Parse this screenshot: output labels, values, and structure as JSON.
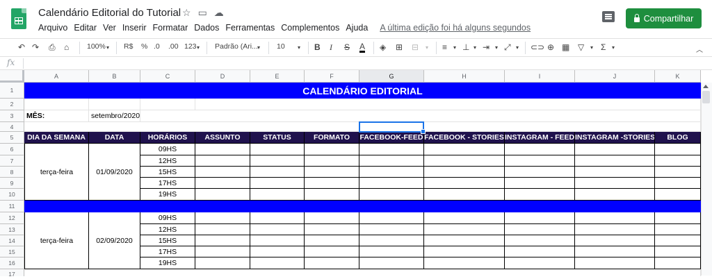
{
  "title": "Calendário Editorial do Tutorial",
  "menu": [
    "Arquivo",
    "Editar",
    "Ver",
    "Inserir",
    "Formatar",
    "Dados",
    "Ferramentas",
    "Complementos",
    "Ajuda"
  ],
  "last_edit": "A última edição foi há alguns segundos",
  "share_label": "Compartilhar",
  "toolbar": {
    "zoom": "100%",
    "currency": "R$",
    "percent": "%",
    "dec_less": ".0",
    "dec_more": ".00",
    "format": "123",
    "font": "Padrão (Ari...",
    "size": "10",
    "bold": "B",
    "italic": "I",
    "strike": "S",
    "textcolor": "A",
    "sigma": "Σ"
  },
  "fx_label": "fx",
  "columns": [
    "A",
    "B",
    "C",
    "D",
    "E",
    "F",
    "G",
    "H",
    "I",
    "J",
    "K"
  ],
  "selected_column": "G",
  "rows": [
    "1",
    "2",
    "3",
    "4",
    "5",
    "6",
    "7",
    "8",
    "9",
    "10",
    "11",
    "12",
    "13",
    "14",
    "15",
    "16",
    "17"
  ],
  "sheet": {
    "banner": "CALENDÁRIO EDITORIAL",
    "mes_label": "MÊS:",
    "mes_value": "setembro/2020",
    "headers": [
      "DIA DA SEMANA",
      "DATA",
      "HORÁRIOS",
      "ASSUNTO",
      "STATUS",
      "FORMATO",
      "FACEBOOK-FEED",
      "FACEBOOK - STORIES",
      "INSTAGRAM - FEED",
      "INSTAGRAM -STORIES",
      "BLOG"
    ],
    "blocks": [
      {
        "weekday": "terça-feira",
        "date": "01/09/2020",
        "times": [
          "09HS",
          "12HS",
          "15HS",
          "17HS",
          "19HS"
        ]
      },
      {
        "weekday": "terça-feira",
        "date": "02/09/2020",
        "times": [
          "09HS",
          "12HS",
          "15HS",
          "17HS",
          "19HS"
        ]
      }
    ]
  },
  "colors": {
    "banner": "#0000ff",
    "header_bg": "#20124d",
    "share": "#1e8e3e",
    "logo": "#23a566"
  }
}
